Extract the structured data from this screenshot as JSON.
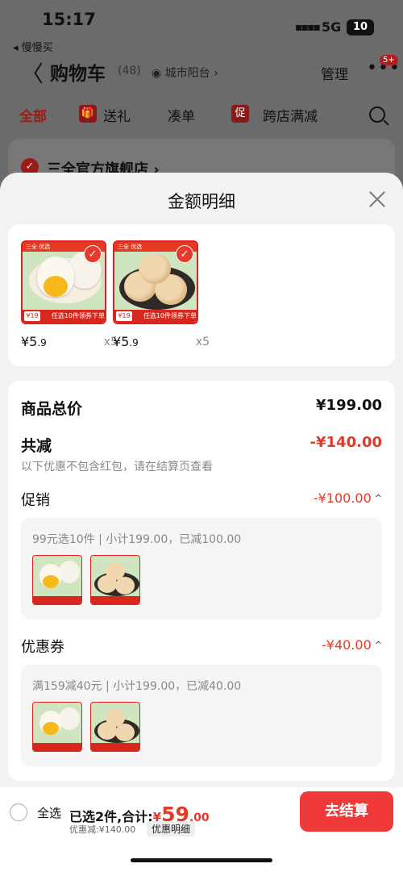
{
  "status_bar": {
    "time": "15:17",
    "back_app": "◂ 慢慢买",
    "signal": "▪▪▪▪",
    "network": "5G",
    "battery": "10"
  },
  "cart_header": {
    "back_glyph": "〈",
    "title": "购物车",
    "count": "(48)",
    "location": "◉ 城市阳台 ›",
    "manage": "管理",
    "more": "•••",
    "badge": "5+"
  },
  "tabs": {
    "all": "全部",
    "gift_icon": "gift-icon",
    "gift": "送礼",
    "bundle": "凑单",
    "promo_icon_text": "促",
    "cross_store": "跨店满减"
  },
  "shop": {
    "check": "✓",
    "name": "三全官方旗舰店 ›"
  },
  "sheet": {
    "title": "金额明细"
  },
  "items": [
    {
      "price_int": "¥5",
      "price_dec": ".9",
      "qty": "x5",
      "top_label": "三全 优选",
      "banner": "任选10件领券下单",
      "price_badge": "¥19",
      "tick": "✓"
    },
    {
      "price_int": "¥5",
      "price_dec": ".9",
      "qty": "x5",
      "top_label": "三全 优选",
      "banner": "任选10件领券下单",
      "price_badge": "¥19",
      "tick": "✓"
    }
  ],
  "details": {
    "total_label": "商品总价",
    "total_value": "¥199.00",
    "discount_label": "共减",
    "discount_value": "-¥140.00",
    "note": "以下优惠不包含红包，请在结算页查看",
    "promo_label": "促销",
    "promo_value": "-¥100.00",
    "promo_text": "99元选10件 | 小计199.00，已减100.00",
    "coupon_label": "优惠券",
    "coupon_value": "-¥40.00",
    "coupon_text": "满159减40元 | 小计199.00，已减40.00",
    "caret": "^"
  },
  "bottom_bar": {
    "select_all": "全选",
    "selected_text": "已选2件,合计:",
    "total_currency": "¥",
    "total_int": "59",
    "total_dec": ".00",
    "discount_text": "优惠减:¥140.00",
    "detail_link": "优惠明细",
    "checkout": "去结算"
  },
  "colors": {
    "accent": "#e33a2a",
    "checkout_bg": "#f03a3a",
    "sheet_bg": "#f2f2f2"
  }
}
